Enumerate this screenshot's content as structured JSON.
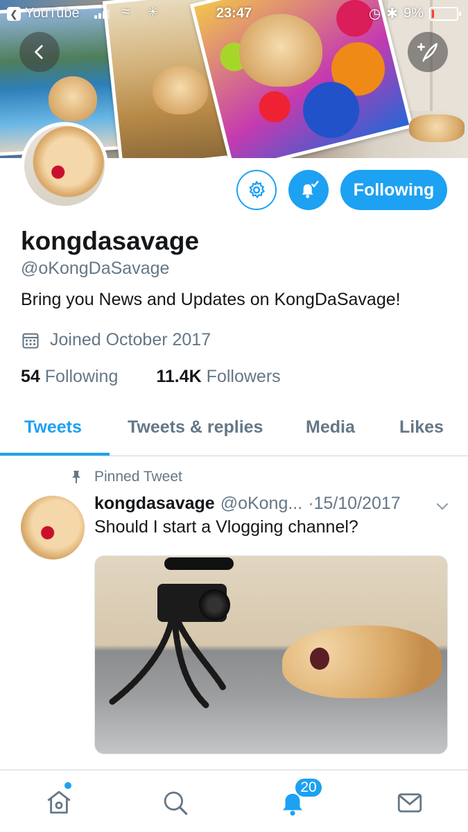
{
  "status_bar": {
    "back_app_label": "YouTube",
    "time": "23:47",
    "battery_percent": "9%",
    "battery_level": 0.09
  },
  "colors": {
    "accent": "#1da1f2",
    "secondary_text": "#657786",
    "primary_text": "#14171a"
  },
  "header_icons": {
    "back": "chevron-left-icon",
    "compose": "compose-tweet-icon"
  },
  "profile": {
    "display_name": "kongdasavage",
    "handle": "@oKongDaSavage",
    "bio": "Bring you News and Updates on KongDaSavage!",
    "joined": "Joined October 2017",
    "following_count": "54",
    "following_label": "Following",
    "followers_count": "11.4K",
    "followers_label": "Followers"
  },
  "actions": {
    "following_button": "Following"
  },
  "tabs": [
    {
      "label": "Tweets",
      "active": true
    },
    {
      "label": "Tweets & replies",
      "active": false
    },
    {
      "label": "Media",
      "active": false
    },
    {
      "label": "Likes",
      "active": false
    }
  ],
  "tweet": {
    "pinned_label": "Pinned Tweet",
    "author_name": "kongdasavage",
    "author_handle": "@oKong...",
    "date": "·15/10/2017",
    "text": "Should I start a Vlogging channel?"
  },
  "bottom_nav": {
    "items": [
      "home-icon",
      "search-icon",
      "notifications-icon",
      "messages-icon"
    ],
    "notifications_badge": "20"
  }
}
